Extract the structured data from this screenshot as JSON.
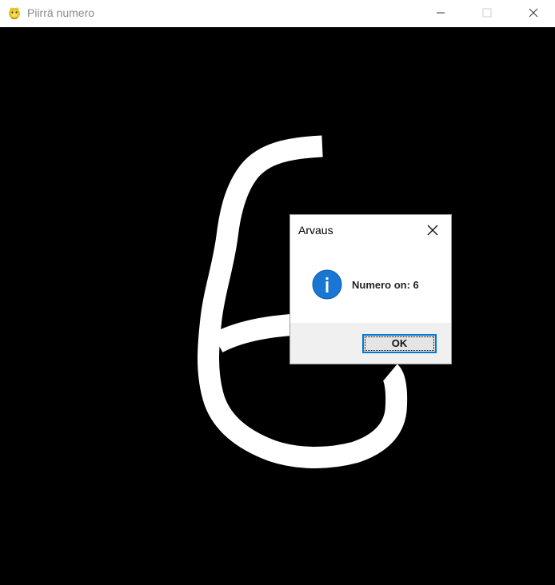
{
  "window": {
    "title": "Piirrä numero",
    "icon": "pygame-snake-icon",
    "controls": {
      "minimize": "minimize-icon",
      "maximize": "maximize-icon",
      "close": "close-icon"
    }
  },
  "canvas": {
    "background": "#000000",
    "stroke_color": "#ffffff"
  },
  "dialog": {
    "title": "Arvaus",
    "icon": "info-icon",
    "message": "Numero on: 6",
    "ok_label": "OK",
    "accent": "#0078d7"
  }
}
